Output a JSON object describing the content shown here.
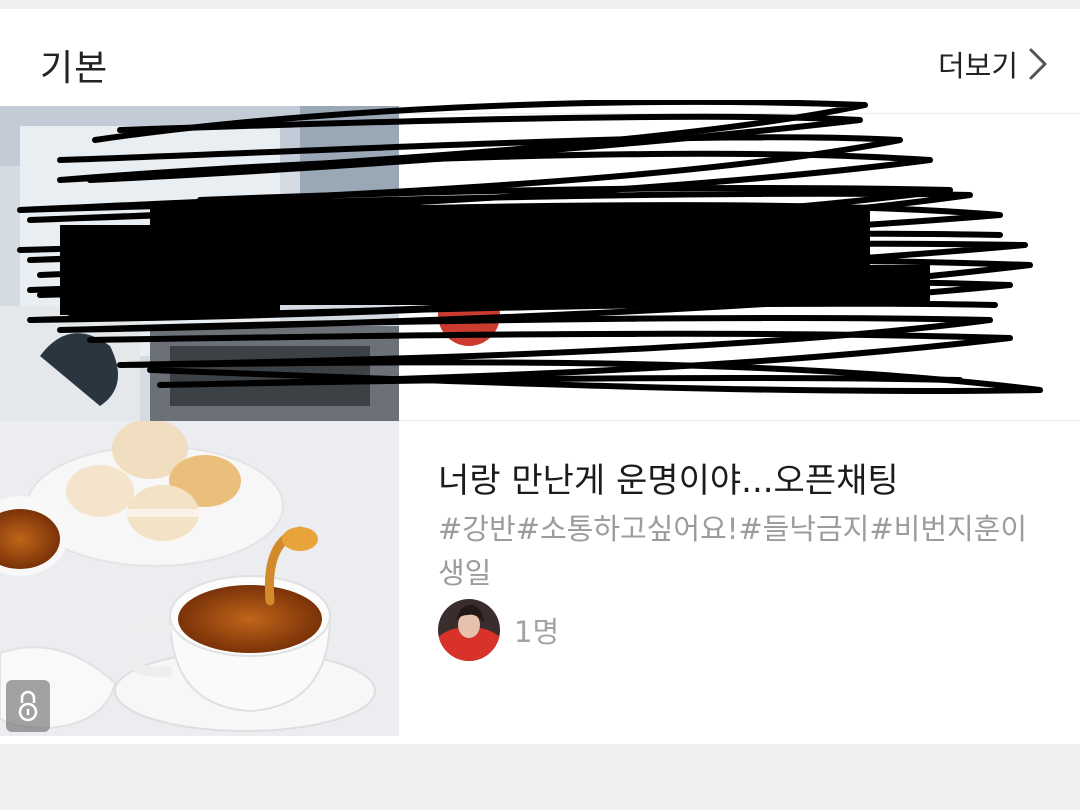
{
  "section": {
    "title": "기본",
    "more_label": "더보기"
  },
  "rooms": [
    {
      "title": "",
      "tags": "",
      "member_count": ""
    },
    {
      "title": "너랑 만난게 운명이야...오픈채팅",
      "tags": "#강반#소통하고싶어요!#들낙금지#비번지훈이생일",
      "member_count": "1명",
      "locked": true
    }
  ],
  "colors": {
    "tag_text": "#9c9c9c",
    "title_text": "#1b1b1b",
    "background": "#f0f0f0"
  },
  "icons": [
    "chevron-right-icon",
    "lock-icon"
  ]
}
